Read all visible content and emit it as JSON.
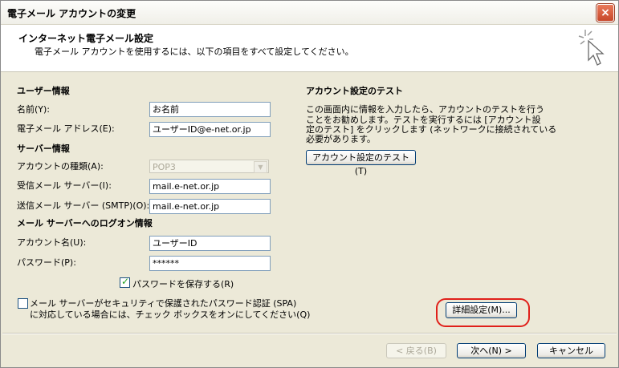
{
  "window": {
    "title": "電子メール アカウントの変更",
    "close_icon": "×"
  },
  "header": {
    "title": "インターネット電子メール設定",
    "description": "電子メール アカウントを使用するには、以下の項目をすべて設定してください。",
    "icon": "sparkle-cursor-icon"
  },
  "user_info": {
    "heading": "ユーザー情報",
    "name_label": "名前(Y):",
    "name_value": "お名前",
    "email_label": "電子メール アドレス(E):",
    "email_value": "ユーザーID@e-net.or.jp"
  },
  "server_info": {
    "heading": "サーバー情報",
    "account_type_label": "アカウントの種類(A):",
    "account_type_value": "POP3",
    "incoming_label": "受信メール サーバー(I):",
    "incoming_value": "mail.e-net.or.jp",
    "outgoing_label": "送信メール サーバー (SMTP)(O):",
    "outgoing_value": "mail.e-net.or.jp"
  },
  "logon_info": {
    "heading": "メール サーバーへのログオン情報",
    "account_name_label": "アカウント名(U):",
    "account_name_value": "ユーザーID",
    "password_label": "パスワード(P):",
    "password_value": "******",
    "save_password_label": "パスワードを保存する(R)",
    "save_password_checked": true,
    "spa_line1": "メール サーバーがセキュリティで保護されたパスワード認証 (SPA)",
    "spa_line2": "に対応している場合には、チェック ボックスをオンにしてください(Q)",
    "spa_checked": false
  },
  "test": {
    "heading": "アカウント設定のテスト",
    "desc_line1": "この画面内に情報を入力したら、アカウントのテストを行う",
    "desc_line2": "ことをお勧めします。テストを実行するには [アカウント設",
    "desc_line3": "定のテスト] をクリックします (ネットワークに接続されている",
    "desc_line4": "必要があります。",
    "button_label": "アカウント設定のテスト(T)"
  },
  "buttons": {
    "more_settings": "詳細設定(M)...",
    "back": "< 戻る(B)",
    "next": "次へ(N) >",
    "cancel": "キャンセル"
  },
  "colors": {
    "highlight": "#e0201a",
    "window_bg": "#ece9d8",
    "checkmark": "#21a121"
  }
}
